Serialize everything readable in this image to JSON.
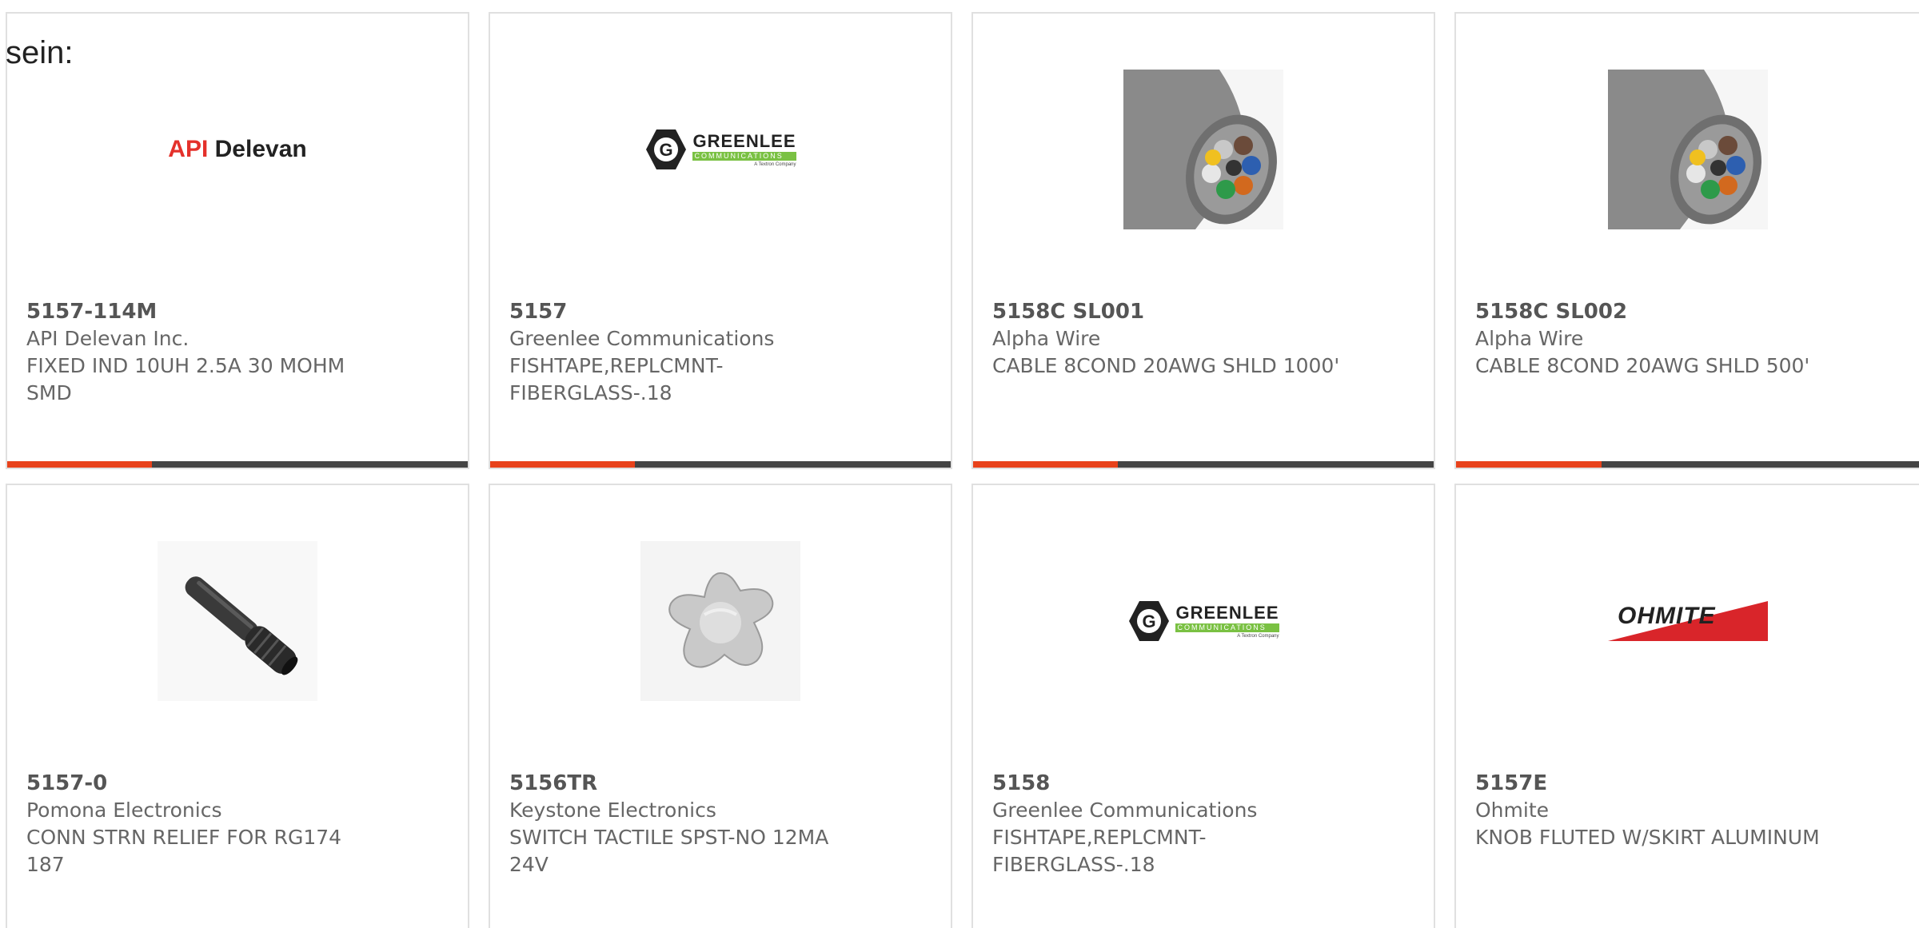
{
  "lead_text": "sein:",
  "colors": {
    "accent": "#e8421b",
    "bar": "#444444",
    "border": "#e0e0e0"
  },
  "products": [
    {
      "part_number": "5157-114M",
      "manufacturer": "API Delevan Inc.",
      "description": "FIXED IND 10UH 2.5A 30 MOHM SMD",
      "image": "api-delevan-logo",
      "logo_text": {
        "part1": "API",
        "part2": "Delevan"
      }
    },
    {
      "part_number": "5157",
      "manufacturer": "Greenlee Communications",
      "description": "FISHTAPE,REPLCMNT-FIBERGLASS-.18",
      "image": "greenlee-logo",
      "logo_text": {
        "name": "GREENLEE",
        "sub": "COMMUNICATIONS",
        "tag": "A Textron Company"
      }
    },
    {
      "part_number": "5158C SL001",
      "manufacturer": "Alpha Wire",
      "description": "CABLE 8COND 20AWG SHLD 1000'",
      "image": "cable-photo"
    },
    {
      "part_number": "5158C SL002",
      "manufacturer": "Alpha Wire",
      "description": "CABLE 8COND 20AWG SHLD 500'",
      "image": "cable-photo"
    },
    {
      "part_number": "5157-0",
      "manufacturer": "Pomona Electronics",
      "description": "CONN STRN RELIEF FOR RG174 187",
      "image": "strain-relief-photo"
    },
    {
      "part_number": "5156TR",
      "manufacturer": "Keystone Electronics",
      "description": "SWITCH TACTILE SPST-NO 12MA 24V",
      "image": "tactile-switch-photo"
    },
    {
      "part_number": "5158",
      "manufacturer": "Greenlee Communications",
      "description": "FISHTAPE,REPLCMNT-FIBERGLASS-.18",
      "image": "greenlee-logo",
      "logo_text": {
        "name": "GREENLEE",
        "sub": "COMMUNICATIONS",
        "tag": "A Textron Company"
      }
    },
    {
      "part_number": "5157E",
      "manufacturer": "Ohmite",
      "description": "KNOB FLUTED W/SKIRT ALUMINUM",
      "image": "ohmite-logo",
      "logo_text": {
        "name": "OHMITE"
      }
    }
  ]
}
